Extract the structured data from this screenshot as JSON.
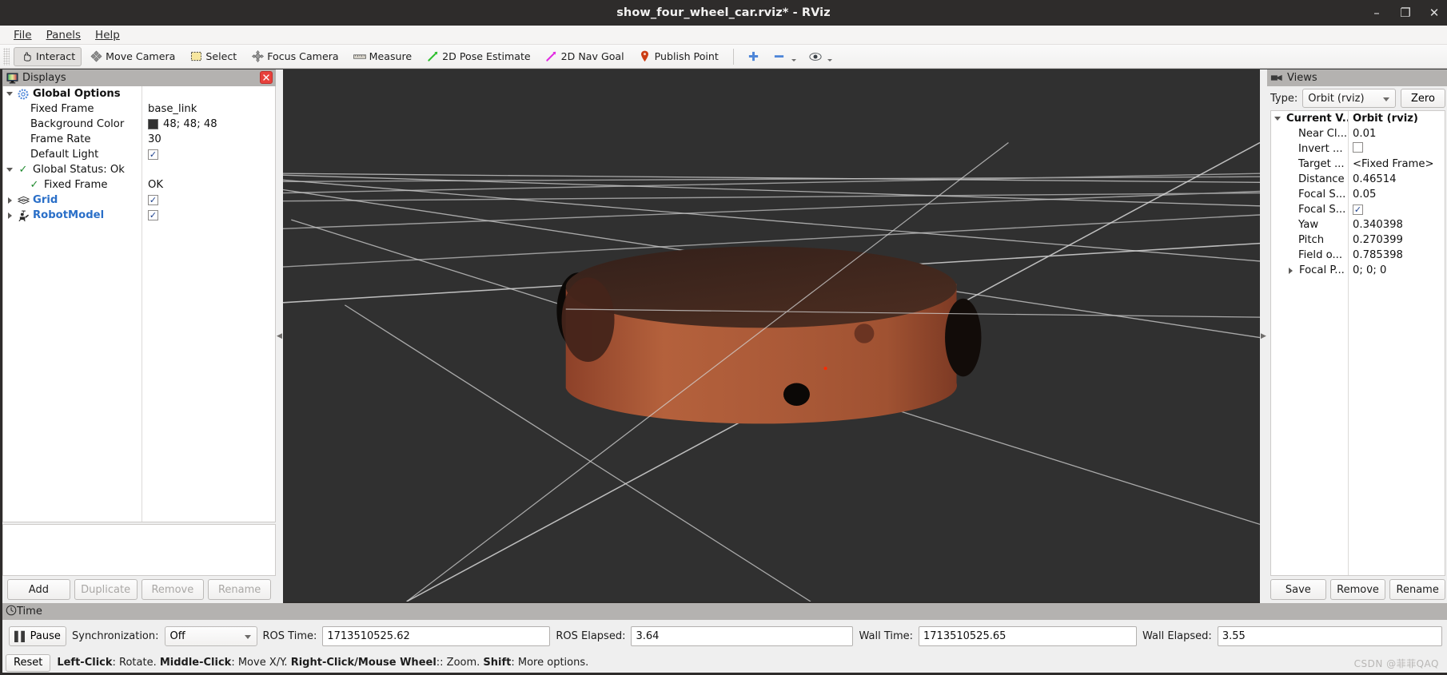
{
  "window": {
    "title": "show_four_wheel_car.rviz* - RViz",
    "minimize": "–",
    "maximize": "❐",
    "close": "✕"
  },
  "menu": {
    "items": [
      {
        "label": "File",
        "mnemonic": "F"
      },
      {
        "label": "Panels",
        "mnemonic": "P"
      },
      {
        "label": "Help",
        "mnemonic": "H"
      }
    ]
  },
  "toolbar": {
    "items": [
      {
        "label": "Interact",
        "icon": "hand-icon",
        "active": true
      },
      {
        "label": "Move Camera",
        "icon": "move-camera-icon",
        "active": false
      },
      {
        "label": "Select",
        "icon": "select-rect-icon",
        "active": false
      },
      {
        "label": "Focus Camera",
        "icon": "focus-camera-icon",
        "active": false
      },
      {
        "label": "Measure",
        "icon": "ruler-icon",
        "active": false
      },
      {
        "label": "2D Pose Estimate",
        "icon": "pose-arrow-icon",
        "active": false
      },
      {
        "label": "2D Nav Goal",
        "icon": "nav-goal-arrow-icon",
        "active": false
      },
      {
        "label": "Publish Point",
        "icon": "map-pin-icon",
        "active": false
      }
    ],
    "extra": [
      {
        "icon": "plus-icon",
        "label": ""
      },
      {
        "icon": "minus-icon",
        "label": ""
      },
      {
        "icon": "eye-icon",
        "label": ""
      }
    ]
  },
  "displays": {
    "panel_title": "Displays",
    "panel_icon": "displays-icon",
    "close_glyph": "✕",
    "rows": [
      {
        "indent": 0,
        "expander": "down",
        "icon": "gear-icon",
        "label": "Global Options",
        "bold": true,
        "value_type": "none",
        "value": ""
      },
      {
        "indent": 1,
        "expander": "none",
        "icon": "none",
        "label": "Fixed Frame",
        "bold": false,
        "value_type": "text",
        "value": "base_link"
      },
      {
        "indent": 1,
        "expander": "none",
        "icon": "none",
        "label": "Background Color",
        "bold": false,
        "value_type": "color",
        "value": "48; 48; 48",
        "color": "#303030"
      },
      {
        "indent": 1,
        "expander": "none",
        "icon": "none",
        "label": "Frame Rate",
        "bold": false,
        "value_type": "text",
        "value": "30"
      },
      {
        "indent": 1,
        "expander": "none",
        "icon": "none",
        "label": "Default Light",
        "bold": false,
        "value_type": "checkbox",
        "value": "✓"
      },
      {
        "indent": 0,
        "expander": "down",
        "icon": "check-icon",
        "label": "Global Status: Ok",
        "bold": false,
        "value_type": "none",
        "value": ""
      },
      {
        "indent": 1,
        "expander": "none",
        "icon": "check-icon",
        "label": "Fixed Frame",
        "bold": false,
        "value_type": "text",
        "value": "OK"
      },
      {
        "indent": 0,
        "expander": "right",
        "icon": "grid-icon",
        "label": "Grid",
        "bold": true,
        "link": true,
        "value_type": "checkbox",
        "value": "✓"
      },
      {
        "indent": 0,
        "expander": "right",
        "icon": "robot-icon",
        "label": "RobotModel",
        "bold": true,
        "link": true,
        "value_type": "checkbox",
        "value": "✓"
      }
    ],
    "buttons": [
      {
        "label": "Add",
        "enabled": true
      },
      {
        "label": "Duplicate",
        "enabled": false
      },
      {
        "label": "Remove",
        "enabled": false
      },
      {
        "label": "Rename",
        "enabled": false
      }
    ]
  },
  "views": {
    "panel_title": "Views",
    "panel_icon": "views-camera-icon",
    "type_label": "Type:",
    "type_value": "Orbit (rviz)",
    "zero_button": "Zero",
    "rows": [
      {
        "indent": 0,
        "expander": "down",
        "label": "Current V...",
        "bold": true,
        "value_type": "text",
        "value": "Orbit (rviz)",
        "value_bold": true
      },
      {
        "indent": 1,
        "expander": "none",
        "label": "Near Cl...",
        "bold": false,
        "value_type": "text",
        "value": "0.01"
      },
      {
        "indent": 1,
        "expander": "none",
        "label": "Invert ...",
        "bold": false,
        "value_type": "checkbox_empty",
        "value": ""
      },
      {
        "indent": 1,
        "expander": "none",
        "label": "Target ...",
        "bold": false,
        "value_type": "text",
        "value": "<Fixed Frame>"
      },
      {
        "indent": 1,
        "expander": "none",
        "label": "Distance",
        "bold": false,
        "value_type": "text",
        "value": "0.46514"
      },
      {
        "indent": 1,
        "expander": "none",
        "label": "Focal S...",
        "bold": false,
        "value_type": "text",
        "value": "0.05"
      },
      {
        "indent": 1,
        "expander": "none",
        "label": "Focal S...",
        "bold": false,
        "value_type": "checkbox",
        "value": "✓"
      },
      {
        "indent": 1,
        "expander": "none",
        "label": "Yaw",
        "bold": false,
        "value_type": "text",
        "value": "0.340398"
      },
      {
        "indent": 1,
        "expander": "none",
        "label": "Pitch",
        "bold": false,
        "value_type": "text",
        "value": "0.270399"
      },
      {
        "indent": 1,
        "expander": "none",
        "label": "Field o...",
        "bold": false,
        "value_type": "text",
        "value": "0.785398"
      },
      {
        "indent": 1,
        "expander": "right",
        "label": "Focal P...",
        "bold": false,
        "value_type": "text",
        "value": "0; 0; 0"
      }
    ],
    "buttons": [
      {
        "label": "Save"
      },
      {
        "label": "Remove"
      },
      {
        "label": "Rename"
      }
    ]
  },
  "time": {
    "panel_title": "Time",
    "panel_icon": "clock-icon",
    "pause_label": "Pause",
    "sync_label": "Synchronization:",
    "sync_value": "Off",
    "ros_time_label": "ROS Time:",
    "ros_time_value": "1713510525.62",
    "ros_elapsed_label": "ROS Elapsed:",
    "ros_elapsed_value": "3.64",
    "wall_time_label": "Wall Time:",
    "wall_time_value": "1713510525.65",
    "wall_elapsed_label": "Wall Elapsed:",
    "wall_elapsed_value": "3.55"
  },
  "status": {
    "reset_label": "Reset",
    "hint_parts": [
      {
        "text": "Left-Click",
        "bold": true
      },
      {
        "text": ": Rotate. ",
        "bold": false
      },
      {
        "text": "Middle-Click",
        "bold": true
      },
      {
        "text": ": Move X/Y. ",
        "bold": false
      },
      {
        "text": "Right-Click/Mouse Wheel",
        "bold": true
      },
      {
        "text": ":: Zoom. ",
        "bold": false
      },
      {
        "text": "Shift",
        "bold": true
      },
      {
        "text": ": More options.",
        "bold": false
      }
    ],
    "watermark": "CSDN @菲菲QAQ"
  },
  "viewport": {
    "background_color": "#303030",
    "grid_color": "#b7b7b7",
    "robot_body_color": "#b4613c",
    "robot_body_dark": "#3a231b",
    "robot_wheel_color": "#0c0807",
    "axis_marker_color": "#ff2a00",
    "scene_description": "Orange cylindrical four-wheel robot chassis on a dark grey ground plane with a white wireframe grid"
  }
}
